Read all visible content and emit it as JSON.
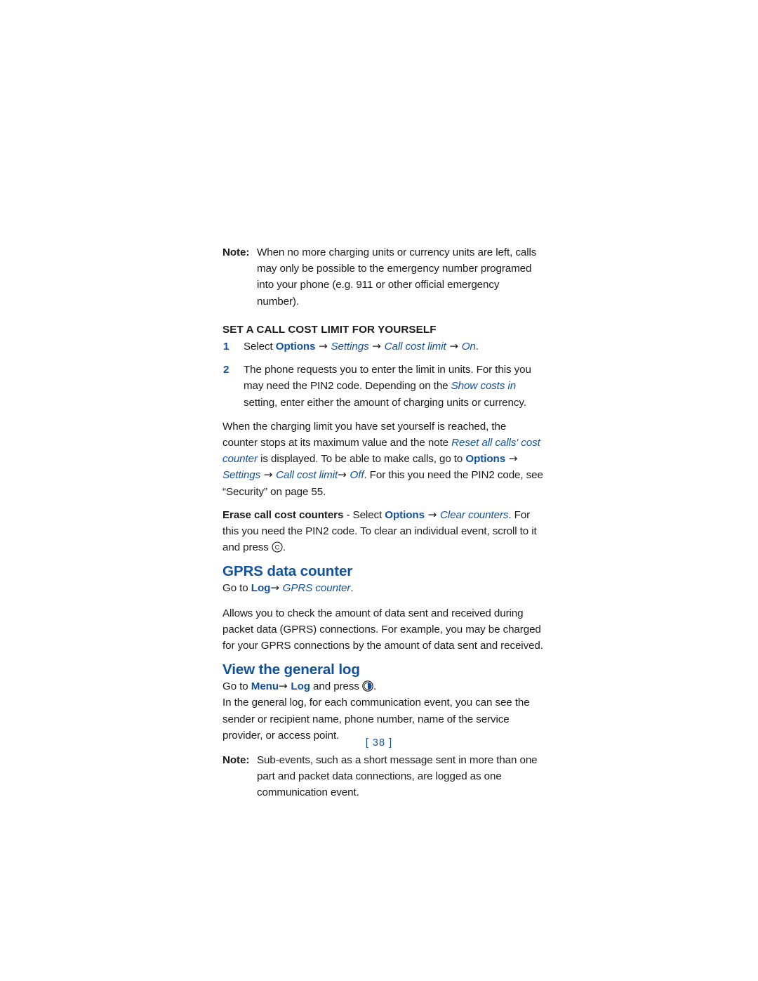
{
  "document": {
    "type": "user-guide-page",
    "page_number_label": "[ 38 ]",
    "colors": {
      "accent_blue": "#12519e",
      "body_text": "#1b1b1b",
      "background": "#ffffff"
    }
  },
  "note_top": {
    "label": "Note:",
    "text": "When no more charging units or currency units are left, calls may only be possible to the emergency number programed into your phone (e.g. 911 or other official emergency number)."
  },
  "subhead": {
    "text": "SET A CALL COST LIMIT FOR YOURSELF"
  },
  "steps": [
    {
      "num": "1",
      "parts": [
        {
          "t": "Select ",
          "style": "plain"
        },
        {
          "t": "Options",
          "style": "blue-bold"
        },
        {
          "t": " → ",
          "style": "arrow"
        },
        {
          "t": "Settings",
          "style": "blue-italic"
        },
        {
          "t": " → ",
          "style": "arrow"
        },
        {
          "t": "Call cost limit",
          "style": "blue-italic"
        },
        {
          "t": " → ",
          "style": "arrow"
        },
        {
          "t": "On",
          "style": "blue-italic"
        },
        {
          "t": ".",
          "style": "plain"
        }
      ]
    },
    {
      "num": "2",
      "parts": [
        {
          "t": "The phone requests you to enter the limit in units. For this you may need the PIN2 code. Depending on the ",
          "style": "plain"
        },
        {
          "t": "Show costs in",
          "style": "blue-italic"
        },
        {
          "t": " setting, enter either the amount of charging units or currency.",
          "style": "plain"
        }
      ]
    }
  ],
  "para_charging_limit": {
    "parts": [
      {
        "t": "When the charging limit you have set yourself is reached, the counter stops at its maximum value and the note ",
        "style": "plain"
      },
      {
        "t": "Reset all calls' cost counter",
        "style": "blue-italic"
      },
      {
        "t": " is displayed. To be able to make calls, go to ",
        "style": "plain"
      },
      {
        "t": "Options",
        "style": "blue-bold"
      },
      {
        "t": " → ",
        "style": "arrow"
      },
      {
        "t": "Settings",
        "style": "blue-italic"
      },
      {
        "t": " → ",
        "style": "arrow"
      },
      {
        "t": "Call cost limit",
        "style": "blue-italic"
      },
      {
        "t": "→ ",
        "style": "arrow"
      },
      {
        "t": "Off",
        "style": "blue-italic"
      },
      {
        "t": ". For this you need the PIN2 code, see “Security” on page 55.",
        "style": "plain"
      }
    ]
  },
  "para_erase": {
    "parts": [
      {
        "t": "Erase call cost counters",
        "style": "bold"
      },
      {
        "t": " - Select ",
        "style": "plain"
      },
      {
        "t": "Options",
        "style": "blue-bold"
      },
      {
        "t": " → ",
        "style": "arrow"
      },
      {
        "t": "Clear counters",
        "style": "blue-italic"
      },
      {
        "t": ". For this you need the PIN2 code. To clear an individual event, scroll to it and press ",
        "style": "plain"
      },
      {
        "t": "[clear-key-icon]",
        "style": "icon-clear"
      },
      {
        "t": ".",
        "style": "plain"
      }
    ]
  },
  "heading_gprs": {
    "text": "GPRS data counter"
  },
  "goto_gprs": {
    "parts": [
      {
        "t": "Go to ",
        "style": "plain"
      },
      {
        "t": "Log",
        "style": "blue-bold"
      },
      {
        "t": "→ ",
        "style": "arrow"
      },
      {
        "t": "GPRS counter",
        "style": "blue-italic"
      },
      {
        "t": ".",
        "style": "plain"
      }
    ]
  },
  "para_gprs_body": {
    "text": "Allows you to check the amount of data sent and received during packet data (GPRS) connections. For example, you may be charged for your GPRS connections by the amount of data sent and received."
  },
  "heading_view_log": {
    "text": "View the general log"
  },
  "goto_menu_log": {
    "parts": [
      {
        "t": "Go to ",
        "style": "plain"
      },
      {
        "t": "Menu",
        "style": "blue-bold"
      },
      {
        "t": "→ ",
        "style": "arrow"
      },
      {
        "t": "Log",
        "style": "blue-bold"
      },
      {
        "t": " and press ",
        "style": "plain"
      },
      {
        "t": "[navi-key-icon]",
        "style": "icon-navi"
      },
      {
        "t": ".",
        "style": "plain"
      }
    ]
  },
  "para_general_log": {
    "text": "In the general log, for each communication event, you can see the sender or recipient name, phone number, name of the service provider, or access point."
  },
  "note_bottom": {
    "label": "Note:",
    "text": "Sub-events, such as a short message sent in more than one part and packet data connections, are logged as one communication event."
  },
  "icons": {
    "clear_key": {
      "name": "clear-key-icon",
      "glyph_letter": "C",
      "shape": "circle-outline"
    },
    "navi_key": {
      "name": "navi-key-icon",
      "shape": "circle-with-blue-disc"
    }
  }
}
